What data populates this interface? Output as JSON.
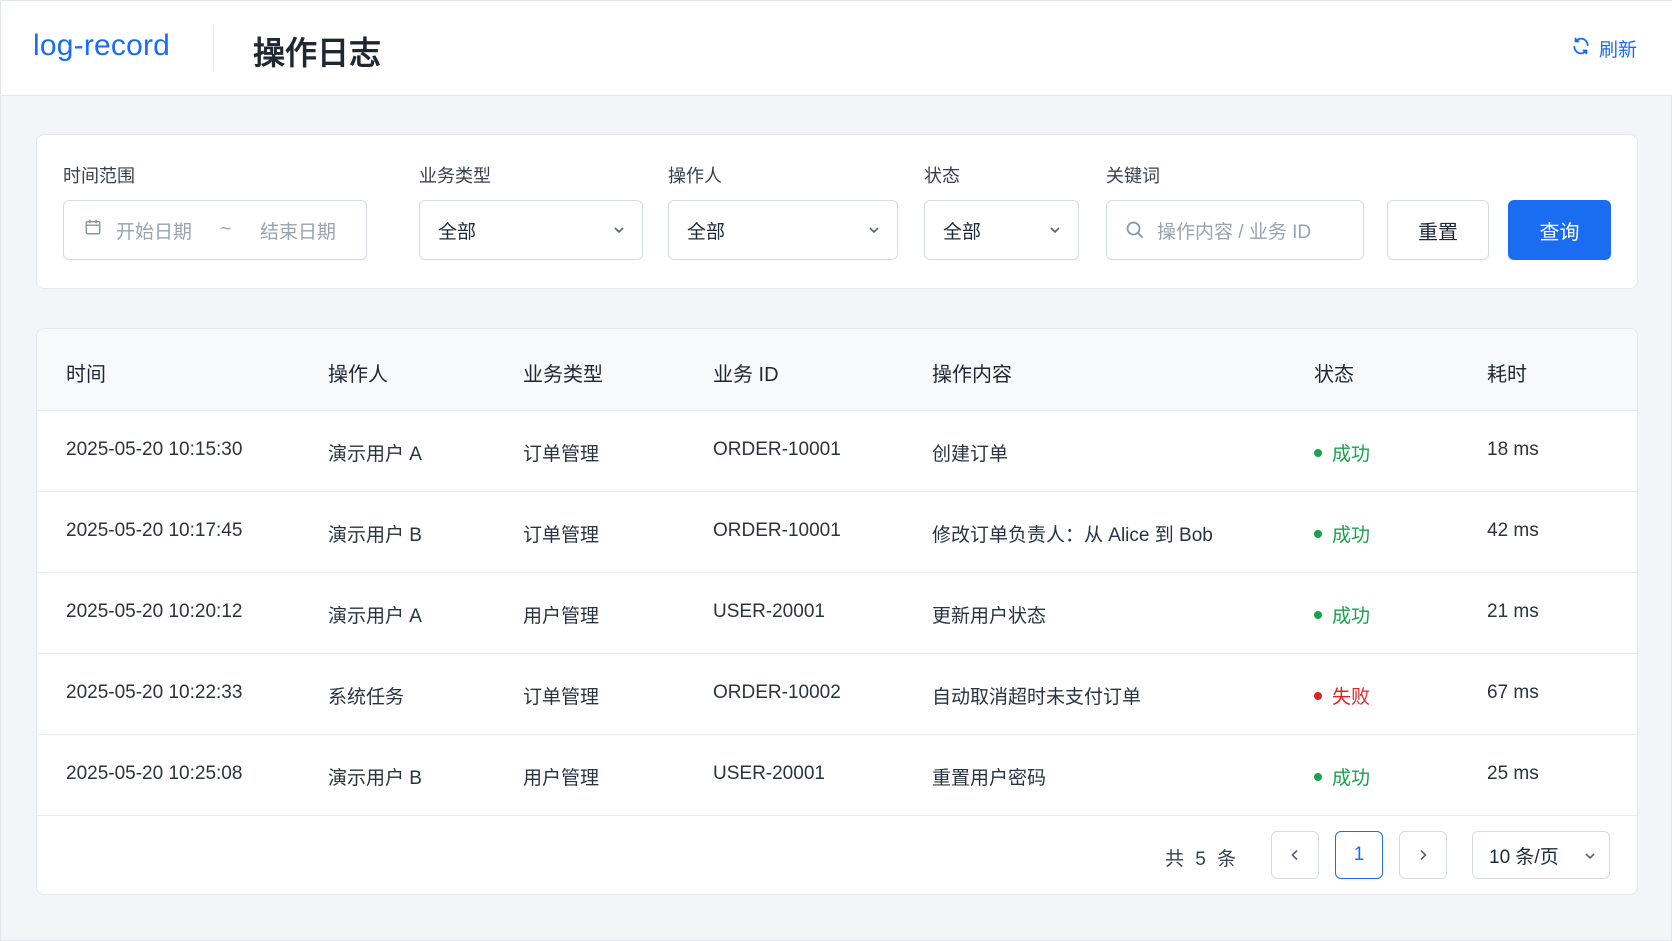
{
  "header": {
    "brand": "log-record",
    "title": "操作日志",
    "refresh_label": "刷新"
  },
  "filters": {
    "time_range": {
      "label": "时间范围",
      "start_placeholder": "开始日期",
      "separator": "~",
      "end_placeholder": "结束日期"
    },
    "biz_type": {
      "label": "业务类型",
      "value": "全部"
    },
    "operator": {
      "label": "操作人",
      "value": "全部"
    },
    "status": {
      "label": "状态",
      "value": "全部"
    },
    "keyword": {
      "label": "关键词",
      "placeholder": "操作内容 / 业务 ID"
    },
    "reset_label": "重置",
    "query_label": "查询"
  },
  "table": {
    "columns": [
      "时间",
      "操作人",
      "业务类型",
      "业务 ID",
      "操作内容",
      "状态",
      "耗时"
    ],
    "rows": [
      {
        "time": "2025-05-20 10:15:30",
        "operator": "演示用户 A",
        "biz_type": "订单管理",
        "biz_id": "ORDER-10001",
        "content": "创建订单",
        "status": "成功",
        "duration": "18 ms"
      },
      {
        "time": "2025-05-20 10:17:45",
        "operator": "演示用户 B",
        "biz_type": "订单管理",
        "biz_id": "ORDER-10001",
        "content": "修改订单负责人：从 Alice 到 Bob",
        "status": "成功",
        "duration": "42 ms"
      },
      {
        "time": "2025-05-20 10:20:12",
        "operator": "演示用户 A",
        "biz_type": "用户管理",
        "biz_id": "USER-20001",
        "content": "更新用户状态",
        "status": "成功",
        "duration": "21 ms"
      },
      {
        "time": "2025-05-20 10:22:33",
        "operator": "系统任务",
        "biz_type": "订单管理",
        "biz_id": "ORDER-10002",
        "content": "自动取消超时未支付订单",
        "status": "失败",
        "duration": "67 ms"
      },
      {
        "time": "2025-05-20 10:25:08",
        "operator": "演示用户 B",
        "biz_type": "用户管理",
        "biz_id": "USER-20001",
        "content": "重置用户密码",
        "status": "成功",
        "duration": "25 ms"
      }
    ]
  },
  "pagination": {
    "total_text": "共 5 条",
    "current_page": "1",
    "page_size": "10 条/页"
  },
  "colors": {
    "accent": "#1a6cf0",
    "success": "#16a34a",
    "fail": "#e02424"
  }
}
